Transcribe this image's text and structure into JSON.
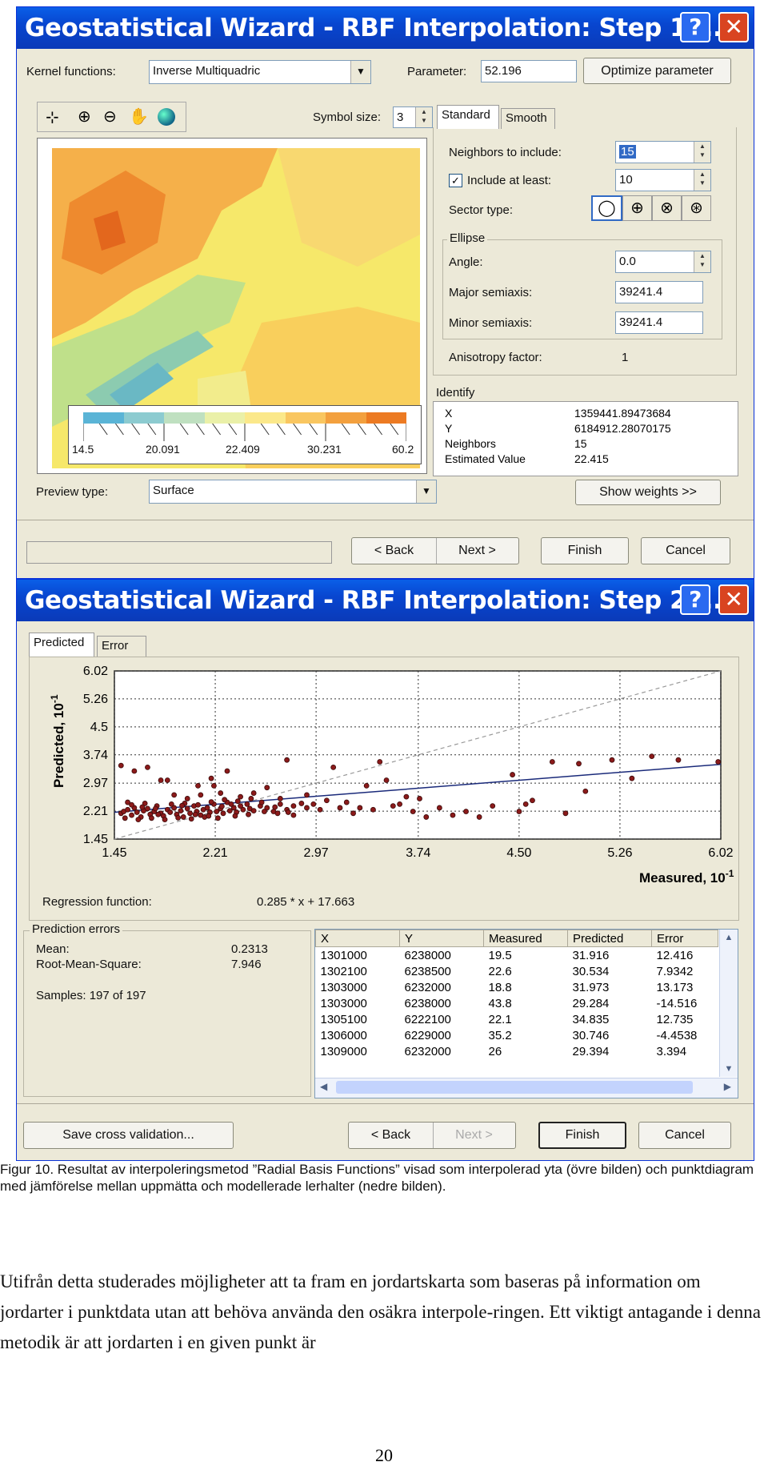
{
  "step1": {
    "title": "Geostatistical Wizard - RBF Interpolation: Step 1 ...",
    "help_glyph": "?",
    "close_glyph": "✕",
    "kernel_label": "Kernel functions:",
    "kernel_value": "Inverse Multiquadric",
    "parameter_label": "Parameter:",
    "parameter_value": "52.196",
    "optimize_label": "Optimize parameter",
    "symbol_size_label": "Symbol size:",
    "symbol_size_value": "3",
    "tabs": [
      "Standard",
      "Smooth"
    ],
    "neighbors_label": "Neighbors to include:",
    "neighbors_value": "15",
    "include_least_label": "Include at least:",
    "include_least_value": "10",
    "sector_label": "Sector type:",
    "ellipse_title": "Ellipse",
    "angle_label": "Angle:",
    "angle_value": "0.0",
    "major_label": "Major semiaxis:",
    "major_value": "39241.4",
    "minor_label": "Minor semiaxis:",
    "minor_value": "39241.4",
    "aniso_label": "Anisotropy factor:",
    "aniso_value": "1",
    "identify_title": "Identify",
    "identify_rows": [
      {
        "k": "X",
        "v": "1359441.89473684"
      },
      {
        "k": "Y",
        "v": "6184912.28070175"
      },
      {
        "k": "Neighbors",
        "v": "15"
      },
      {
        "k": "Estimated Value",
        "v": "22.415"
      }
    ],
    "legend_ticks": [
      "14.5",
      "20.091",
      "22.409",
      "30.231",
      "60.2"
    ],
    "legend_colors": [
      "#5ab4d6",
      "#8ccbd0",
      "#bfe0c0",
      "#eaf0a8",
      "#fbe88a",
      "#f9c660",
      "#f3a03e",
      "#ec7a22"
    ],
    "preview_label": "Preview type:",
    "preview_value": "Surface",
    "show_weights_label": "Show weights >>",
    "back_label": "< Back",
    "next_label": "Next >",
    "finish_label": "Finish",
    "cancel_label": "Cancel"
  },
  "step2": {
    "title": "Geostatistical Wizard - RBF Interpolation: Step 2 ...",
    "help_glyph": "?",
    "close_glyph": "✕",
    "tabs": [
      "Predicted",
      "Error"
    ],
    "regression_label": "Regression function:",
    "regression_value": "0.285 * x + 17.663",
    "pred_errors_title": "Prediction errors",
    "mean_label": "Mean:",
    "mean_value": "0.2313",
    "rms_label": "Root-Mean-Square:",
    "rms_value": "7.946",
    "samples_label": "Samples: 197 of 197",
    "table_headers": [
      "X",
      "Y",
      "Measured",
      "Predicted",
      "Error"
    ],
    "table_rows": [
      [
        "1301000",
        "6238000",
        "19.5",
        "31.916",
        "12.416"
      ],
      [
        "1302100",
        "6238500",
        "22.6",
        "30.534",
        "7.9342"
      ],
      [
        "1303000",
        "6232000",
        "18.8",
        "31.973",
        "13.173"
      ],
      [
        "1303000",
        "6238000",
        "43.8",
        "29.284",
        "-14.516"
      ],
      [
        "1305100",
        "6222100",
        "22.1",
        "34.835",
        "12.735"
      ],
      [
        "1306000",
        "6229000",
        "35.2",
        "30.746",
        "-4.4538"
      ],
      [
        "1309000",
        "6232000",
        "26",
        "29.394",
        "3.394"
      ]
    ],
    "save_label": "Save cross validation...",
    "back_label": "< Back",
    "next_label": "Next >",
    "finish_label": "Finish",
    "cancel_label": "Cancel"
  },
  "chart_data": {
    "type": "scatter",
    "xlabel": "Measured, 10",
    "xlabel_exp": "-1",
    "ylabel": "Predicted, 10",
    "ylabel_exp": "-1",
    "x_ticks": [
      "1.45",
      "2.21",
      "2.97",
      "3.74",
      "4.50",
      "5.26",
      "6.02"
    ],
    "y_ticks": [
      "6.02",
      "5.26",
      "4.5",
      "3.74",
      "2.97",
      "2.21",
      "1.45"
    ],
    "xlim": [
      1.45,
      6.02
    ],
    "ylim": [
      1.45,
      6.02
    ],
    "regression": {
      "slope": 0.285,
      "intercept": 1.7663
    },
    "colors": {
      "point": "#8b1a1a",
      "regression": "#1a2a7a",
      "reference": "#999999"
    },
    "points": [
      [
        1.5,
        2.15
      ],
      [
        1.52,
        2.2
      ],
      [
        1.55,
        2.25
      ],
      [
        1.58,
        2.1
      ],
      [
        1.6,
        2.3
      ],
      [
        1.62,
        2.18
      ],
      [
        1.65,
        2.05
      ],
      [
        1.67,
        2.22
      ],
      [
        1.7,
        2.28
      ],
      [
        1.72,
        2.12
      ],
      [
        1.75,
        2.2
      ],
      [
        1.77,
        2.35
      ],
      [
        1.8,
        2.15
      ],
      [
        1.82,
        2.08
      ],
      [
        1.85,
        2.25
      ],
      [
        1.87,
        2.18
      ],
      [
        1.9,
        2.3
      ],
      [
        1.92,
        2.12
      ],
      [
        1.95,
        2.22
      ],
      [
        1.97,
        2.05
      ],
      [
        2.0,
        2.28
      ],
      [
        2.02,
        2.15
      ],
      [
        2.05,
        2.35
      ],
      [
        2.07,
        2.2
      ],
      [
        2.1,
        2.1
      ],
      [
        2.12,
        2.25
      ],
      [
        2.15,
        2.3
      ],
      [
        2.17,
        2.18
      ],
      [
        2.2,
        2.4
      ],
      [
        2.22,
        2.2
      ],
      [
        2.25,
        2.28
      ],
      [
        2.27,
        2.15
      ],
      [
        2.3,
        2.45
      ],
      [
        2.32,
        2.22
      ],
      [
        2.35,
        2.3
      ],
      [
        2.37,
        2.18
      ],
      [
        2.4,
        2.35
      ],
      [
        2.42,
        2.25
      ],
      [
        2.45,
        2.4
      ],
      [
        2.47,
        2.28
      ],
      [
        2.5,
        2.22
      ],
      [
        2.55,
        2.35
      ],
      [
        2.6,
        2.3
      ],
      [
        2.65,
        2.2
      ],
      [
        2.7,
        2.4
      ],
      [
        2.75,
        2.25
      ],
      [
        2.8,
        2.35
      ],
      [
        2.9,
        2.3
      ],
      [
        1.55,
        2.45
      ],
      [
        1.6,
        3.3
      ],
      [
        1.5,
        3.45
      ],
      [
        1.7,
        3.4
      ],
      [
        1.8,
        3.05
      ],
      [
        1.9,
        2.65
      ],
      [
        1.85,
        3.05
      ],
      [
        2.0,
        2.55
      ],
      [
        2.1,
        2.65
      ],
      [
        2.2,
        2.9
      ],
      [
        2.3,
        3.3
      ],
      [
        2.25,
        2.7
      ],
      [
        2.4,
        2.6
      ],
      [
        2.5,
        2.7
      ],
      [
        2.6,
        2.85
      ],
      [
        2.7,
        2.55
      ],
      [
        2.75,
        3.6
      ],
      [
        2.8,
        2.1
      ],
      [
        2.9,
        2.65
      ],
      [
        2.95,
        2.4
      ],
      [
        3.0,
        2.25
      ],
      [
        3.05,
        2.5
      ],
      [
        3.1,
        3.4
      ],
      [
        3.2,
        2.45
      ],
      [
        3.3,
        2.3
      ],
      [
        3.35,
        2.9
      ],
      [
        3.4,
        2.25
      ],
      [
        3.45,
        3.55
      ],
      [
        3.5,
        3.05
      ],
      [
        3.6,
        2.4
      ],
      [
        3.7,
        2.2
      ],
      [
        3.75,
        2.55
      ],
      [
        3.8,
        2.05
      ],
      [
        3.9,
        2.3
      ],
      [
        4.0,
        2.1
      ],
      [
        4.1,
        2.2
      ],
      [
        4.2,
        2.05
      ],
      [
        4.3,
        2.35
      ],
      [
        4.45,
        3.2
      ],
      [
        4.5,
        2.2
      ],
      [
        4.6,
        2.5
      ],
      [
        4.75,
        3.55
      ],
      [
        4.85,
        2.15
      ],
      [
        4.95,
        3.5
      ],
      [
        5.2,
        3.6
      ],
      [
        5.35,
        3.1
      ],
      [
        5.5,
        3.7
      ],
      [
        5.7,
        3.6
      ],
      [
        6.0,
        3.55
      ],
      [
        5.0,
        2.75
      ],
      [
        4.55,
        2.4
      ],
      [
        1.53,
        2.02
      ],
      [
        1.63,
        1.98
      ],
      [
        1.73,
        2.02
      ],
      [
        1.83,
        1.98
      ],
      [
        1.93,
        2.03
      ],
      [
        2.03,
        2.0
      ],
      [
        2.13,
        2.05
      ],
      [
        2.23,
        2.02
      ],
      [
        1.58,
        2.38
      ],
      [
        1.68,
        2.42
      ],
      [
        1.78,
        2.12
      ],
      [
        1.88,
        2.4
      ],
      [
        1.98,
        2.42
      ],
      [
        2.08,
        2.38
      ],
      [
        2.18,
        2.46
      ],
      [
        2.28,
        2.52
      ],
      [
        2.38,
        2.48
      ],
      [
        2.48,
        2.55
      ],
      [
        2.58,
        2.2
      ],
      [
        2.68,
        2.15
      ],
      [
        2.18,
        3.1
      ],
      [
        2.08,
        2.9
      ],
      [
        2.33,
        2.4
      ],
      [
        1.66,
        2.32
      ],
      [
        1.76,
        2.28
      ],
      [
        1.96,
        2.36
      ],
      [
        2.06,
        2.12
      ],
      [
        2.16,
        2.08
      ],
      [
        2.26,
        2.34
      ],
      [
        2.36,
        2.08
      ],
      [
        2.46,
        2.12
      ],
      [
        2.56,
        2.45
      ],
      [
        2.66,
        2.32
      ],
      [
        2.76,
        2.18
      ],
      [
        2.86,
        2.42
      ],
      [
        3.15,
        2.3
      ],
      [
        3.25,
        2.15
      ],
      [
        3.55,
        2.35
      ],
      [
        3.65,
        2.6
      ]
    ]
  },
  "caption": "Figur 10. Resultat av interpoleringsmetod ”Radial Basis Functions” visad som interpolerad yta (övre bilden) och punktdiagram med jämförelse mellan uppmätta och modellerade lerhalter (nedre bilden).",
  "paragraph": "Utifrån detta studerades möjligheter att ta fram en jordartskarta som baseras på information om jordarter i punktdata utan att behöva använda den osäkra interpole-ringen. Ett viktigt antagande i denna metodik är att jordarten i en given punkt är",
  "page_number": "20"
}
